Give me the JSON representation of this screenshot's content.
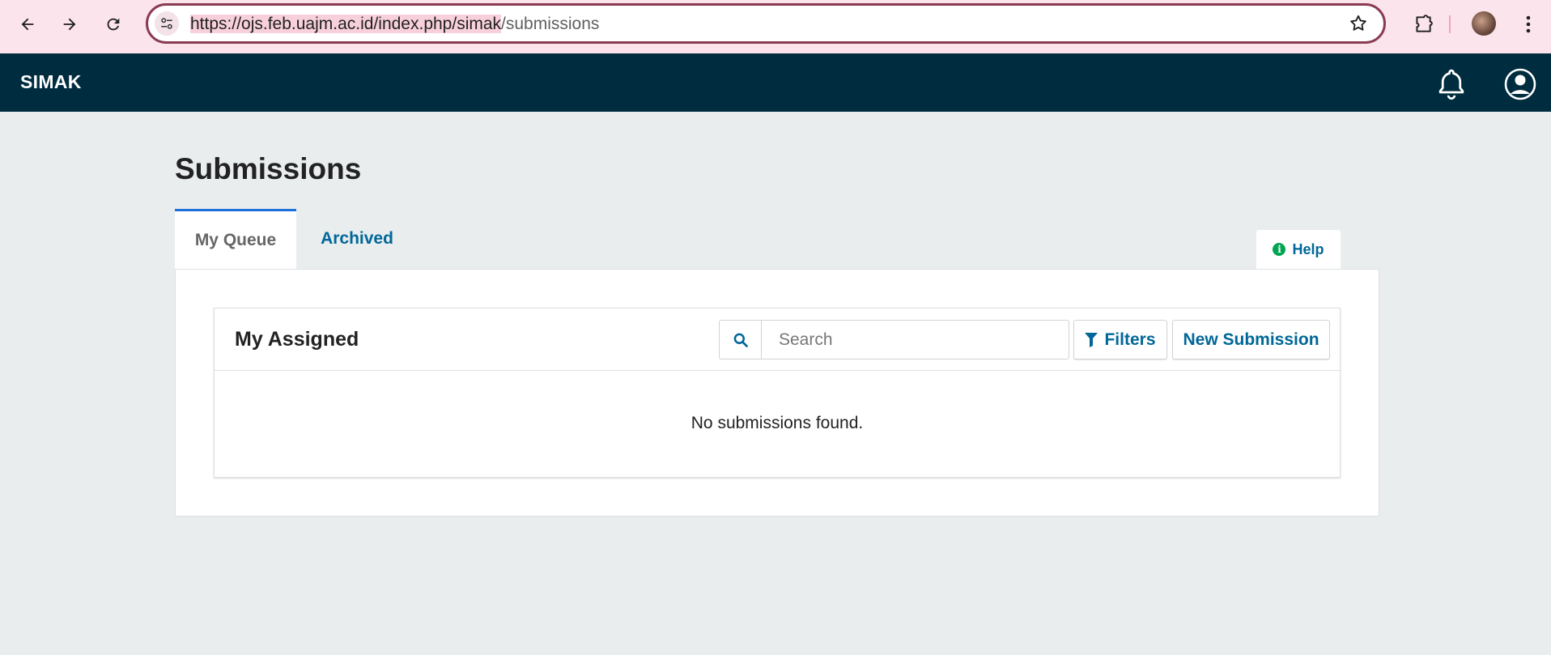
{
  "browser": {
    "url_host": "https://ojs.feb.uajm.ac.id/index.php/simak",
    "url_path": "/submissions"
  },
  "header": {
    "brand": "SIMAK"
  },
  "main": {
    "title": "Submissions",
    "tabs": [
      {
        "label": "My Queue",
        "active": true
      },
      {
        "label": "Archived",
        "active": false
      }
    ],
    "help_label": "Help",
    "list": {
      "title": "My Assigned",
      "search_placeholder": "Search",
      "filters_label": "Filters",
      "new_submission_label": "New Submission",
      "empty_message": "No submissions found."
    }
  },
  "colors": {
    "header_bg": "#002c40",
    "accent": "#006798",
    "active_tab_border": "#1e6fd9",
    "help_icon": "#00a550",
    "page_bg": "#e9edee"
  }
}
